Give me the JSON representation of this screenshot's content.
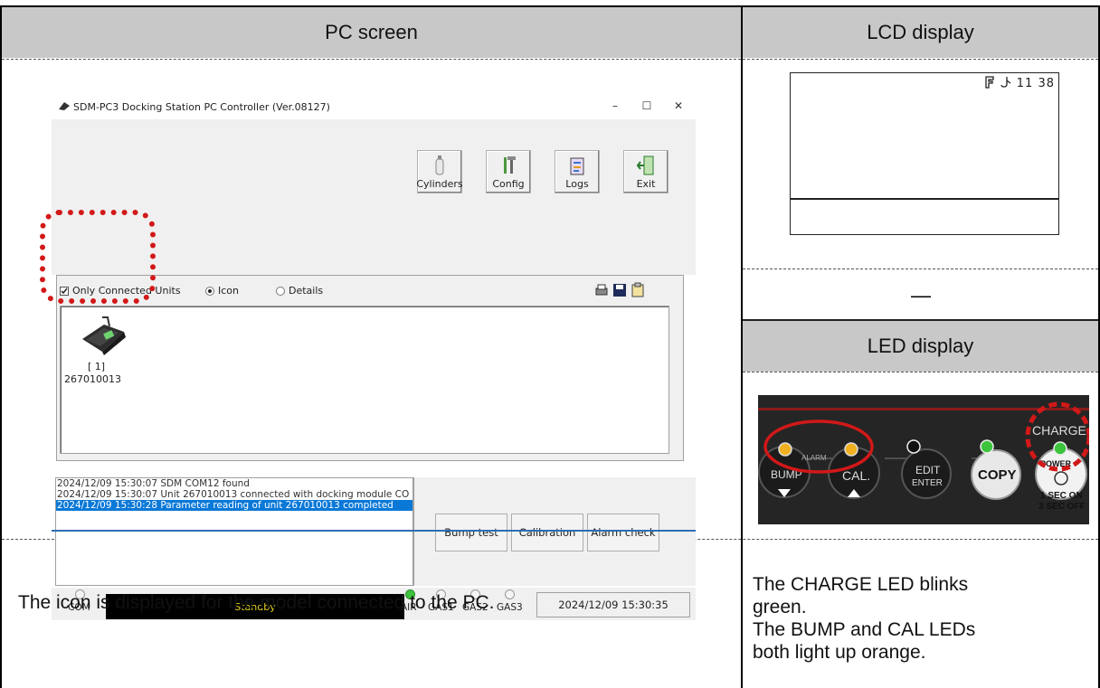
{
  "headers": {
    "pc_screen": "PC screen",
    "lcd_display": "LCD display",
    "led_display": "LED display"
  },
  "pc_window": {
    "title": "SDM-PC3 Docking Station PC Controller (Ver.08127)",
    "window_buttons": [
      "–",
      "☐",
      "✕"
    ],
    "toolbar_buttons": [
      "Cylinders",
      "Config",
      "Logs",
      "Exit"
    ],
    "options": {
      "only_connected": "Only Connected Units",
      "icon": "Icon",
      "details": "Details",
      "selected_view": "Icon"
    },
    "unit": {
      "index": "[ 1]",
      "serial": "267010013"
    },
    "log_lines": [
      "2024/12/09 15:30:07 SDM COM12 found",
      "2024/12/09 15:30:07 Unit 267010013 connected with docking module CO",
      "2024/12/09 15:30:28 Parameter reading of unit 267010013 completed"
    ],
    "command_buttons": [
      "Bump test",
      "Calibration",
      "Alarm check"
    ],
    "status": {
      "com_label": "COM",
      "standby": "Standby",
      "air_label": "AIR",
      "gas_labels": [
        "GAS1",
        "GAS2",
        "GAS3"
      ],
      "datetime": "2024/12/09 15:30:35"
    },
    "colors": {
      "standby_text": "#e6d21a",
      "selection": "#0a78d7",
      "highlight_ring": "#d21818"
    }
  },
  "lcd": {
    "status_text": "11  38",
    "dash": "—"
  },
  "led_panel": {
    "labels": {
      "charge": "CHARGE",
      "bump": "BUMP",
      "cal": "CAL.",
      "edit": "EDIT",
      "enter": "ENTER",
      "copy": "COPY",
      "power": "POWER",
      "power_hint_1": "1 SEC ON",
      "power_hint_2": "3 SEC OFF",
      "alarm": "ALARM"
    },
    "led_colors": [
      "orange",
      "orange",
      "black",
      "green",
      "green"
    ]
  },
  "descriptions": {
    "left": "The icon is displayed for the model connected to the PC.",
    "right_lines": [
      "The CHARGE LED blinks",
      "green.",
      "The BUMP and CAL LEDs",
      "both light up orange."
    ]
  }
}
